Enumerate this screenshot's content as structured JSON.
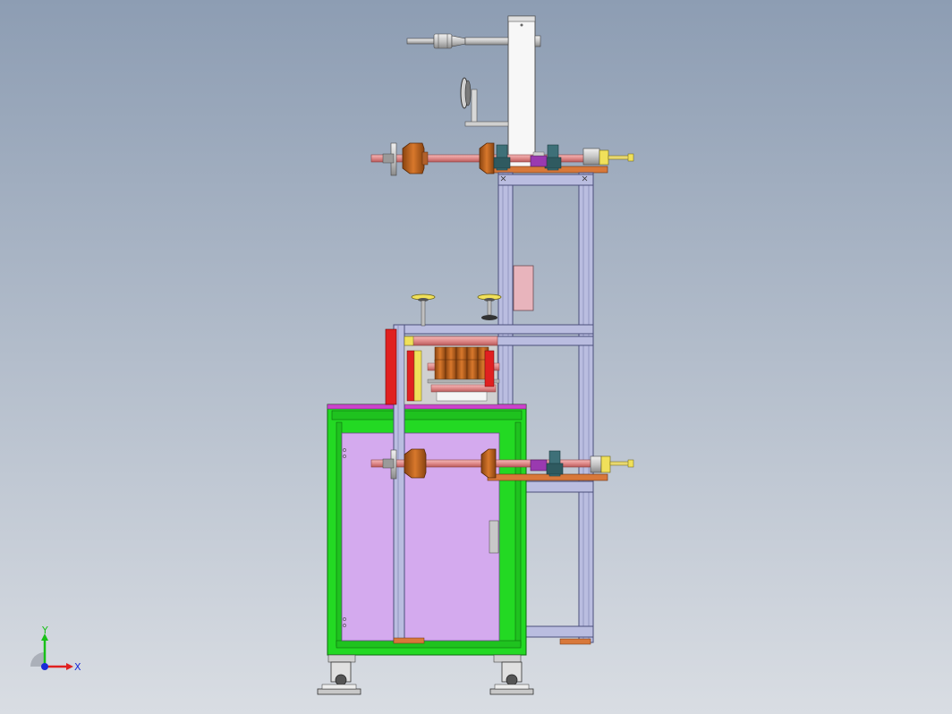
{
  "viewport": {
    "background_top": "#8d9db3",
    "background_bottom": "#d9dde3"
  },
  "colors": {
    "frame_profile": "#b9bde0",
    "frame_edge": "#4a4e7a",
    "green_frame": "#22dd22",
    "green_edge": "#0c7a0c",
    "cabinet_panel": "#d3aaee",
    "shaft": "#e08a8a",
    "roller": "#c8641c",
    "roller_dark": "#7a3a0c",
    "teal_block": "#3a6a70",
    "purple_block": "#9a3ab0",
    "pink_panel": "#e8b4bc",
    "red_panel": "#e02020",
    "yellow": "#f0e05a",
    "orange_plate": "#d8783a",
    "column_white": "#f5f5f5",
    "grey_part": "#c8c8c8"
  },
  "triad": {
    "x_label": "X",
    "y_label": "Y",
    "x_color": "#e02020",
    "y_color": "#18c018",
    "z_color": "#1a2ad8"
  }
}
